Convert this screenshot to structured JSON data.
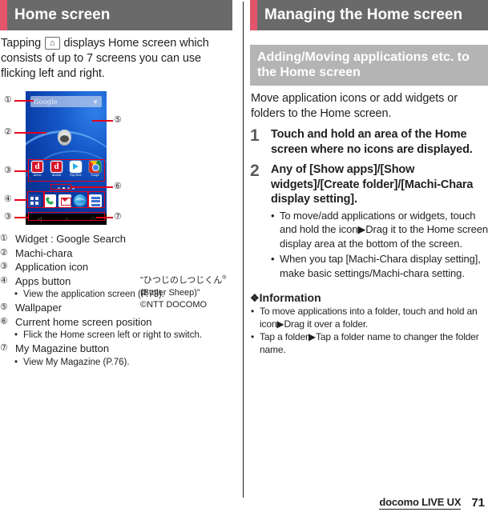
{
  "left": {
    "chapter_title": "Home screen",
    "intro_before": "Tapping",
    "home_key_icon": "home-icon",
    "intro_after": "displays Home screen which consists of up to 7 screens you can use flicking left and right.",
    "figure": {
      "search_widget_label": "Google",
      "mic_icon": "mic-icon",
      "apps": [
        {
          "label": "dmenu",
          "icon": "dmenu-icon"
        },
        {
          "label": "dmarket",
          "icon": "dmarket-icon"
        },
        {
          "label": "Play Store",
          "icon": "play-store-icon"
        },
        {
          "label": "Google",
          "icon": "chrome-icon"
        }
      ],
      "dock": [
        {
          "name": "apps-button",
          "icon": "apps-grid-icon"
        },
        {
          "name": "phone",
          "icon": "phone-icon"
        },
        {
          "name": "mail",
          "icon": "mail-icon"
        },
        {
          "name": "browser",
          "icon": "browser-icon"
        },
        {
          "name": "my-magazine",
          "icon": "my-magazine-icon"
        }
      ],
      "nav": [
        "back",
        "home",
        "recents"
      ],
      "callouts": [
        "①",
        "②",
        "③",
        "④",
        "③",
        "⑤",
        "⑥",
        "⑦"
      ]
    },
    "credit": {
      "line1": "\"ひつじのしつじくん",
      "line1_sup": "®",
      "line2": "(Butler Sheep)\"",
      "line3": "©NTT DOCOMO"
    },
    "legend": [
      {
        "num": "①",
        "text": "Widget : Google Search",
        "sub": []
      },
      {
        "num": "②",
        "text": "Machi-chara",
        "sub": []
      },
      {
        "num": "③",
        "text": "Application icon",
        "sub": []
      },
      {
        "num": "④",
        "text": "Apps button",
        "sub": [
          "View the application screen (P.73)."
        ]
      },
      {
        "num": "⑤",
        "text": "Wallpaper",
        "sub": []
      },
      {
        "num": "⑥",
        "text": "Current home screen position",
        "sub": [
          "Flick the Home screen left or right to switch."
        ]
      },
      {
        "num": "⑦",
        "text": "My Magazine button",
        "sub": [
          "View My Magazine (P.76)."
        ]
      }
    ]
  },
  "right": {
    "chapter_title": "Managing the Home screen",
    "section_title": "Adding/Moving applications etc. to the Home screen",
    "intro": "Move application icons or add widgets or folders to the Home screen.",
    "steps": [
      {
        "num": "1",
        "text": "Touch and hold an area of the Home screen where no icons are displayed.",
        "sub": []
      },
      {
        "num": "2",
        "text": "Any of [Show apps]/[Show widgets]/[Create folder]/[Machi-Chara display setting].",
        "sub": [
          "To move/add applications or widgets, touch and hold the icon▶Drag it to the Home screen display area at the bottom of the screen.",
          "When you tap [Machi-Chara display setting], make basic settings/Machi-chara setting."
        ]
      }
    ],
    "information": {
      "diamond": "❖",
      "title": "Information",
      "items": [
        "To move applications into a folder, touch and hold an icon▶Drag it over a folder.",
        "Tap a folder▶Tap a folder name to changer the folder name."
      ]
    }
  },
  "footer": {
    "brand": "docomo LIVE UX",
    "page": "71"
  },
  "colors": {
    "accent_red": "#e2556b",
    "header_gray": "#6b6a6a",
    "subhead_gray": "#b4b4b4",
    "highlight_red": "#e2001a",
    "text": "#231f20"
  }
}
